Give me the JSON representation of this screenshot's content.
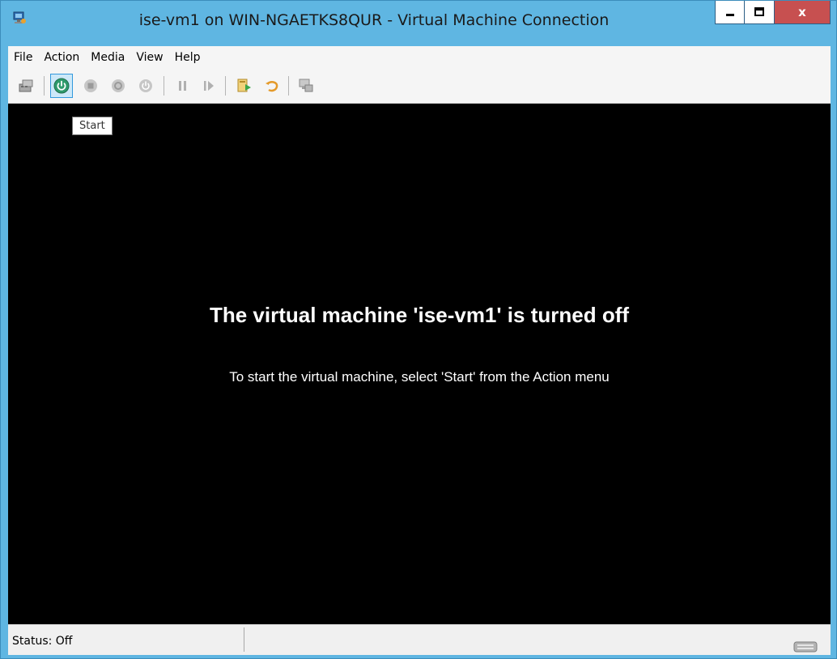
{
  "window": {
    "title": "ise-vm1 on WIN-NGAETKS8QUR - Virtual Machine Connection",
    "close_glyph": "x"
  },
  "menu": [
    {
      "label": "File"
    },
    {
      "label": "Action"
    },
    {
      "label": "Media"
    },
    {
      "label": "View"
    },
    {
      "label": "Help"
    }
  ],
  "toolbar": {
    "icons": [
      "ctrl-alt-del-icon",
      "start-icon",
      "turn-off-icon",
      "shut-down-icon",
      "save-icon",
      "pause-icon",
      "resume-icon",
      "checkpoint-icon",
      "revert-icon",
      "enhanced-session-icon"
    ],
    "active_button": "start"
  },
  "tooltip": {
    "text": "Start"
  },
  "screen": {
    "heading": "The virtual machine 'ise-vm1' is turned off",
    "hint": "To start the virtual machine, select 'Start' from the Action menu"
  },
  "status": {
    "text": "Status: Off"
  },
  "colors": {
    "frame": "#5fb6e2",
    "close_button": "#c75050",
    "start_button": "#2e9a6b",
    "screen": "#000000"
  }
}
